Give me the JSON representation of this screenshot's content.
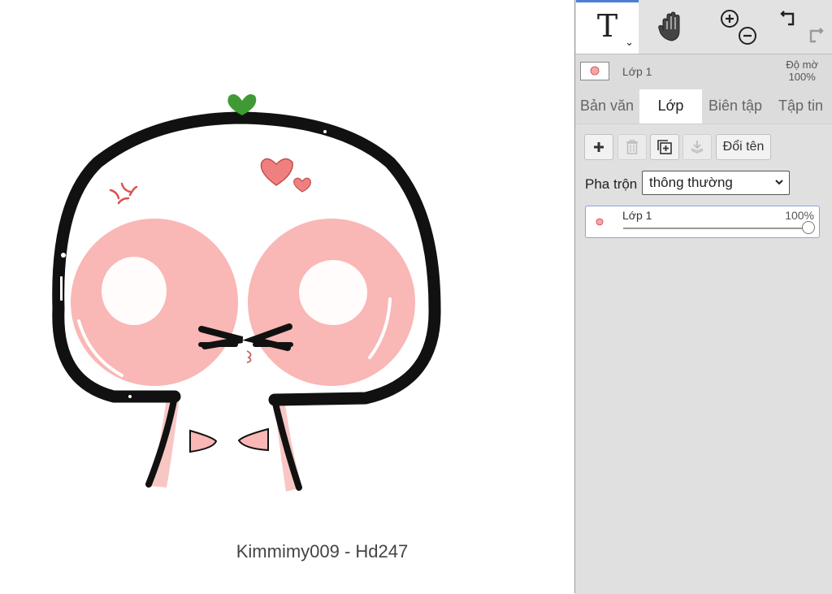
{
  "canvas": {
    "caption": "Kimmimy009 - Hd247"
  },
  "toolbar": {
    "text_tool_glyph": "T",
    "text_tool_chevron": "⌄"
  },
  "layer_info": {
    "current_layer": "Lớp 1",
    "opacity_label": "Độ mờ",
    "opacity_value": "100%"
  },
  "tabs": {
    "text": "Bản văn",
    "layer": "Lớp",
    "edit": "Biên tập",
    "file": "Tập tin"
  },
  "layer_panel": {
    "rename_label": "Đổi tên",
    "blend_label": "Pha trộn",
    "blend_value": "thông thường",
    "layers": [
      {
        "name": "Lớp 1",
        "opacity_text": "100%",
        "opacity": 1.0
      }
    ]
  },
  "colors": {
    "accent": "#4a7fd6",
    "cheek": "#f9b7b5",
    "leaf": "#3f9a35"
  }
}
